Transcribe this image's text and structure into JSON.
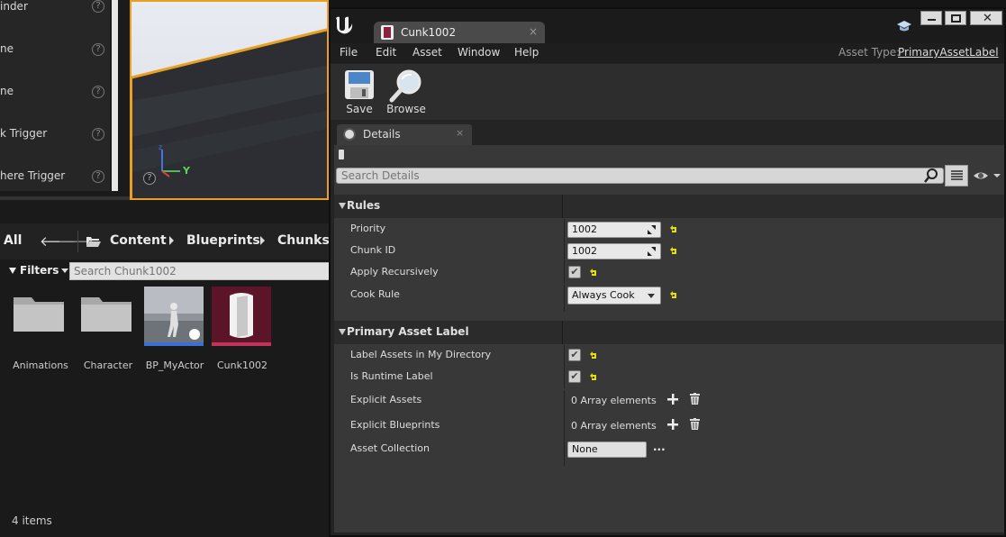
{
  "left": {
    "place_items": [
      {
        "label": "inder"
      },
      {
        "label": "ne"
      },
      {
        "label": "ne"
      },
      {
        "label": "k Trigger"
      },
      {
        "label": "here Trigger"
      }
    ],
    "help_glyph": "?",
    "viewport_axis_label": "Y",
    "content_browser": {
      "all_label": "All",
      "back_glyph": "🡐",
      "forward_glyph": "🡒",
      "breadcrumb": [
        "Content",
        "Blueprints",
        "Chunks"
      ],
      "filters_label": "Filters",
      "search_placeholder": "Search Chunk1002",
      "assets": [
        {
          "name": "Animations",
          "type": "folder"
        },
        {
          "name": "Character",
          "type": "folder"
        },
        {
          "name": "BP_MyActor",
          "type": "blueprint"
        },
        {
          "name": "Cunk1002",
          "type": "primary-asset-label"
        }
      ],
      "item_count": "4 items"
    }
  },
  "editor": {
    "tab_title": "Cunk1002",
    "tab_close": "×",
    "menu": [
      "File",
      "Edit",
      "Asset",
      "Window",
      "Help"
    ],
    "asset_type_label": "Asset Type:",
    "asset_type_value": "PrimaryAssetLabel",
    "toolbar": {
      "save_label": "Save",
      "browse_label": "Browse"
    },
    "details_tab": {
      "label": "Details",
      "close": "×"
    },
    "search_placeholder": "Search Details",
    "sections": {
      "rules": {
        "title": "Rules",
        "priority": {
          "label": "Priority",
          "value": "1002"
        },
        "chunk_id": {
          "label": "Chunk ID",
          "value": "1002"
        },
        "apply_recursively": {
          "label": "Apply Recursively",
          "checked": true
        },
        "cook_rule": {
          "label": "Cook Rule",
          "value": "Always Cook"
        }
      },
      "primary_asset_label": {
        "title": "Primary Asset Label",
        "label_assets_in_dir": {
          "label": "Label Assets in My Directory",
          "checked": true
        },
        "is_runtime_label": {
          "label": "Is Runtime Label",
          "checked": true
        },
        "explicit_assets": {
          "label": "Explicit Assets",
          "value": "0 Array elements"
        },
        "explicit_blueprints": {
          "label": "Explicit Blueprints",
          "value": "0 Array elements"
        },
        "asset_collection": {
          "label": "Asset Collection",
          "value": "None",
          "more": "..."
        }
      }
    },
    "checkmark": "✔",
    "colors": {
      "accent_orange": "#e8a020",
      "reset_yellow": "#e8e000",
      "asset_maroon": "#6b1830",
      "blueprint_blue": "#3a6fd8"
    }
  }
}
